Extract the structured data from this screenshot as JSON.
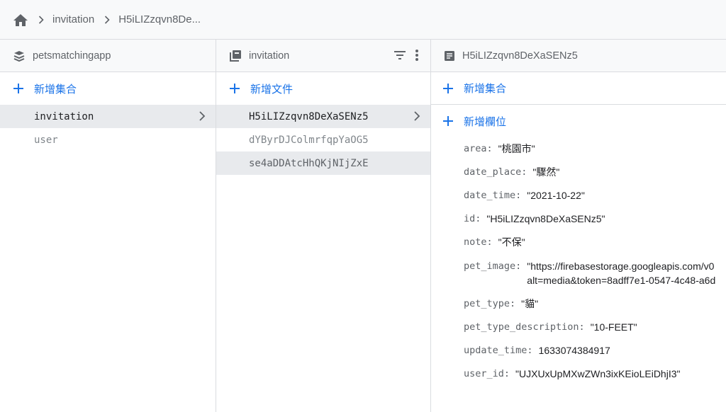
{
  "breadcrumb": {
    "items": [
      "invitation",
      "H5iLIZzqvn8De..."
    ]
  },
  "col1": {
    "title": "petsmatchingapp",
    "add_label": "新增集合",
    "items": [
      "invitation",
      "user"
    ]
  },
  "col2": {
    "title": "invitation",
    "add_label": "新增文件",
    "items": [
      "H5iLIZzqvn8DeXaSENz5",
      "dYByrDJColmrfqpYaOG5",
      "se4aDDAtcHhQKjNIjZxE"
    ]
  },
  "col3": {
    "title": "H5iLIZzqvn8DeXaSENz5",
    "add_collection_label": "新增集合",
    "add_field_label": "新增欄位",
    "fields": [
      {
        "key": "area:",
        "value": "\"桃園市\""
      },
      {
        "key": "date_place:",
        "value": "\"驟然\""
      },
      {
        "key": "date_time:",
        "value": "\"2021-10-22\""
      },
      {
        "key": "id:",
        "value": "\"H5iLIZzqvn8DeXaSENz5\""
      },
      {
        "key": "note:",
        "value": "\"不保\""
      },
      {
        "key": "pet_image:",
        "value_line1": "\"https://firebasestorage.googleapis.com/v0",
        "value_line2": "alt=media&token=8adff7e1-0547-4c48-a6d"
      },
      {
        "key": "pet_type:",
        "value": "\"貓\""
      },
      {
        "key": "pet_type_description:",
        "value": "\"10-FEET\""
      },
      {
        "key": "update_time:",
        "value": "1633074384917"
      },
      {
        "key": "user_id:",
        "value": "\"UJXUxUpMXwZWn3ixKEioLEiDhjI3\""
      }
    ]
  }
}
